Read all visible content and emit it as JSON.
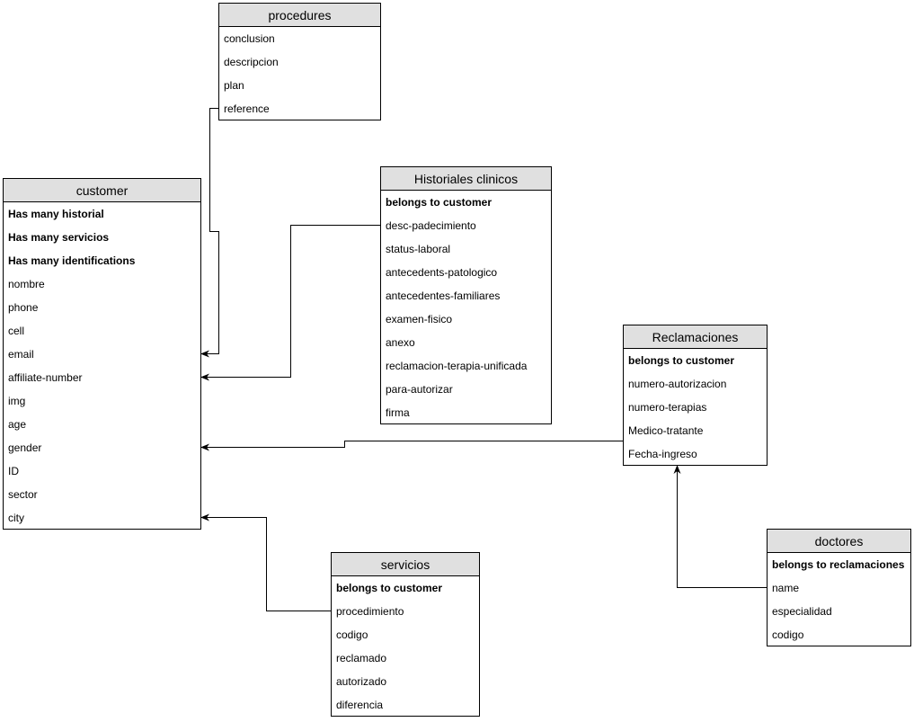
{
  "entities": {
    "procedures": {
      "title": "procedures",
      "fields": [
        {
          "label": "conclusion",
          "bold": false
        },
        {
          "label": "descripcion",
          "bold": false
        },
        {
          "label": "plan",
          "bold": false
        },
        {
          "label": "reference",
          "bold": false
        }
      ]
    },
    "customer": {
      "title": "customer",
      "fields": [
        {
          "label": "Has many historial",
          "bold": true
        },
        {
          "label": "Has many servicios",
          "bold": true
        },
        {
          "label": "Has many identifications",
          "bold": true
        },
        {
          "label": "nombre",
          "bold": false
        },
        {
          "label": "phone",
          "bold": false
        },
        {
          "label": "cell",
          "bold": false
        },
        {
          "label": "email",
          "bold": false
        },
        {
          "label": "affiliate-number",
          "bold": false
        },
        {
          "label": "img",
          "bold": false
        },
        {
          "label": "age",
          "bold": false
        },
        {
          "label": "gender",
          "bold": false
        },
        {
          "label": "ID",
          "bold": false
        },
        {
          "label": "sector",
          "bold": false
        },
        {
          "label": "city",
          "bold": false
        }
      ]
    },
    "historiales": {
      "title": "Historiales clinicos",
      "fields": [
        {
          "label": "belongs to customer",
          "bold": true
        },
        {
          "label": "desc-padecimiento",
          "bold": false
        },
        {
          "label": "status-laboral",
          "bold": false
        },
        {
          "label": "antecedents-patologico",
          "bold": false
        },
        {
          "label": "antecedentes-familiares",
          "bold": false
        },
        {
          "label": "examen-fisico",
          "bold": false
        },
        {
          "label": "anexo",
          "bold": false
        },
        {
          "label": "reclamacion-terapia-unificada",
          "bold": false
        },
        {
          "label": "para-autorizar",
          "bold": false
        },
        {
          "label": "firma",
          "bold": false
        }
      ]
    },
    "reclamaciones": {
      "title": "Reclamaciones",
      "fields": [
        {
          "label": "belongs to customer",
          "bold": true
        },
        {
          "label": "numero-autorizacion",
          "bold": false
        },
        {
          "label": "numero-terapias",
          "bold": false
        },
        {
          "label": "Medico-tratante",
          "bold": false
        },
        {
          "label": "Fecha-ingreso",
          "bold": false
        }
      ]
    },
    "servicios": {
      "title": "servicios",
      "fields": [
        {
          "label": "belongs to customer",
          "bold": true
        },
        {
          "label": "procedimiento",
          "bold": false
        },
        {
          "label": "codigo",
          "bold": false
        },
        {
          "label": "reclamado",
          "bold": false
        },
        {
          "label": "autorizado",
          "bold": false
        },
        {
          "label": "diferencia",
          "bold": false
        }
      ]
    },
    "doctores": {
      "title": "doctores",
      "fields": [
        {
          "label": "belongs to reclamaciones",
          "bold": true
        },
        {
          "label": "name",
          "bold": false
        },
        {
          "label": "especialidad",
          "bold": false
        },
        {
          "label": "codigo",
          "bold": false
        }
      ]
    }
  },
  "relations": [
    {
      "from": "procedures.reference",
      "to": "customer.email"
    },
    {
      "from": "historiales.desc-padecimiento",
      "to": "customer.affiliate-number"
    },
    {
      "from": "reclamaciones.Medico-tratante",
      "to": "customer.gender"
    },
    {
      "from": "servicios.procedimiento",
      "to": "customer.city"
    },
    {
      "from": "doctores.name",
      "to": "reclamaciones"
    }
  ],
  "colors": {
    "header_bg": "#e0e0e0",
    "border": "#000000",
    "line": "#000000"
  }
}
